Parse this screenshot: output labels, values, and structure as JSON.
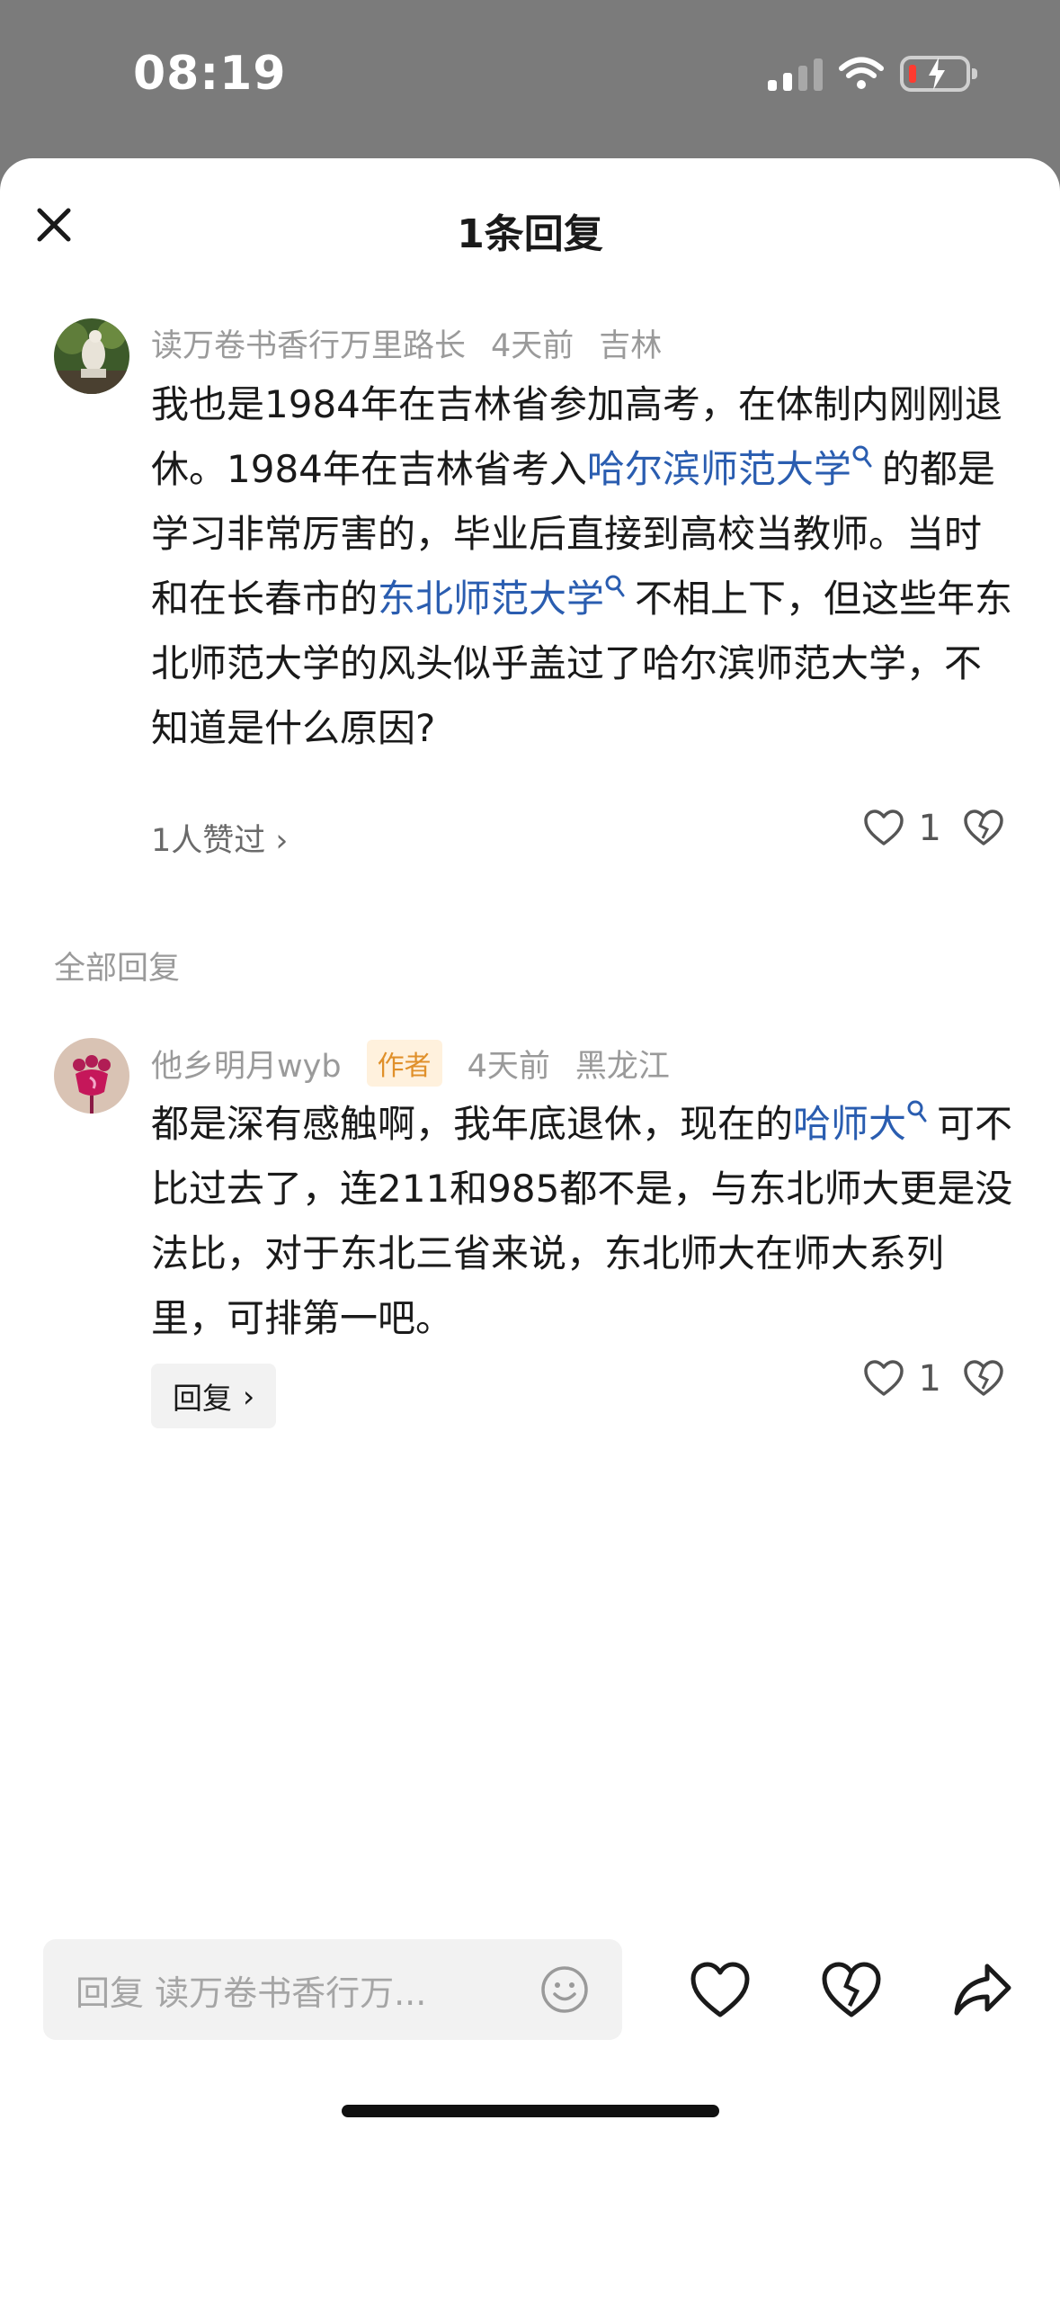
{
  "status_bar": {
    "time": "08:19"
  },
  "sheet": {
    "title": "1条回复"
  },
  "main_comment": {
    "username": "读万卷书香行万里路长",
    "time_ago": "4天前",
    "location": "吉林",
    "text_1": "我也是1984年在吉林省参加高考，在体制内刚刚退休。1984年在吉林省考入",
    "link_1": "哈尔滨师范大学",
    "text_2": "的都是学习非常厉害的，毕业后直接到高校当教师。当时和在长春市的",
    "link_2": "东北师范大学",
    "text_3": "不相上下，但这些年东北师范大学的风头似乎盖过了哈尔滨师范大学，不知道是什么原因?",
    "likes_summary": "1人赞过",
    "like_count": "1"
  },
  "replies_section": {
    "label": "全部回复"
  },
  "reply": {
    "username": "他乡明月wyb",
    "author_tag": "作者",
    "time_ago": "4天前",
    "location": "黑龙江",
    "link_1": "哈师大",
    "text_prefix": "都是深有感触啊，我年底退休，现在的",
    "text_suffix": "可不比过去了，连211和985都不是，与东北师大更是没法比，对于东北三省来说，东北师大在师大系列里，可排第一吧。",
    "reply_button": "回复",
    "like_count": "1"
  },
  "bottom_bar": {
    "placeholder": "回复 读万卷书香行万..."
  },
  "colors": {
    "link": "#2a5db0",
    "author_tag_bg": "#fff1dd",
    "author_tag_text": "#e0902a"
  }
}
